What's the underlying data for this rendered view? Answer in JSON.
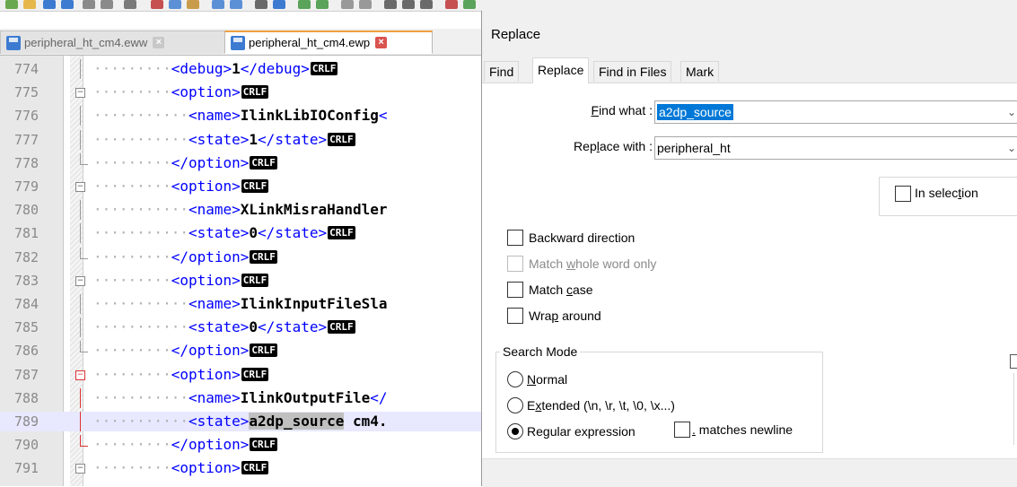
{
  "tabs": [
    {
      "label": "peripheral_ht_cm4.eww",
      "active": false
    },
    {
      "label": "peripheral_ht_cm4.ewp",
      "active": true
    }
  ],
  "crlf_label": "CRLF",
  "editor": {
    "lines": [
      {
        "num": "774",
        "dots": "·········",
        "t1": "<debug>",
        "val": "1",
        "t2": "</debug>",
        "crlf": true
      },
      {
        "num": "775",
        "dots": "·········",
        "t1": "<option>",
        "val": "",
        "t2": "",
        "crlf": true
      },
      {
        "num": "776",
        "dots": "···········",
        "t1": "<name>",
        "val": "IlinkLibIOConfig",
        "t2": "<",
        "crlf": false
      },
      {
        "num": "777",
        "dots": "···········",
        "t1": "<state>",
        "val": "1",
        "t2": "</state>",
        "crlf": true
      },
      {
        "num": "778",
        "dots": "·········",
        "t1": "</option>",
        "val": "",
        "t2": "",
        "crlf": true
      },
      {
        "num": "779",
        "dots": "·········",
        "t1": "<option>",
        "val": "",
        "t2": "",
        "crlf": true
      },
      {
        "num": "780",
        "dots": "···········",
        "t1": "<name>",
        "val": "XLinkMisraHandler",
        "t2": "",
        "crlf": false
      },
      {
        "num": "781",
        "dots": "···········",
        "t1": "<state>",
        "val": "0",
        "t2": "</state>",
        "crlf": true
      },
      {
        "num": "782",
        "dots": "·········",
        "t1": "</option>",
        "val": "",
        "t2": "",
        "crlf": true
      },
      {
        "num": "783",
        "dots": "·········",
        "t1": "<option>",
        "val": "",
        "t2": "",
        "crlf": true
      },
      {
        "num": "784",
        "dots": "···········",
        "t1": "<name>",
        "val": "IlinkInputFileSla",
        "t2": "",
        "crlf": false
      },
      {
        "num": "785",
        "dots": "···········",
        "t1": "<state>",
        "val": "0",
        "t2": "</state>",
        "crlf": true
      },
      {
        "num": "786",
        "dots": "·········",
        "t1": "</option>",
        "val": "",
        "t2": "",
        "crlf": true
      },
      {
        "num": "787",
        "dots": "·········",
        "t1": "<option>",
        "val": "",
        "t2": "",
        "crlf": true
      },
      {
        "num": "788",
        "dots": "···········",
        "t1": "<name>",
        "val": "IlinkOutputFile",
        "t2": "</",
        "crlf": false
      },
      {
        "num": "789",
        "dots": "···········",
        "t1": "<state>",
        "val": "a2dp_source",
        "t2": "",
        "val2": " cm4.",
        "crlf": false
      },
      {
        "num": "790",
        "dots": "·········",
        "t1": "</option>",
        "val": "",
        "t2": "",
        "crlf": true
      },
      {
        "num": "791",
        "dots": "·········",
        "t1": "<option>",
        "val": "",
        "t2": "",
        "crlf": true
      }
    ]
  },
  "dialog": {
    "title": "Replace",
    "tabs": [
      "Find",
      "Replace",
      "Find in Files",
      "Mark"
    ],
    "find_what_label_pre": "",
    "find_what_label_u": "F",
    "find_what_label_post": "ind what :",
    "find_what_value": "a2dp_source",
    "replace_with_label_pre": "Rep",
    "replace_with_label_u": "l",
    "replace_with_label_post": "ace with :",
    "replace_with_value": "peripheral_ht",
    "in_selection_pre": "In selec",
    "in_selection_u": "t",
    "in_selection_post": "ion",
    "backward_direction": "Backward direction",
    "whole_word_pre": "Match ",
    "whole_word_u": "w",
    "whole_word_post": "hole word only",
    "match_case_pre": "Match ",
    "match_case_u": "c",
    "match_case_post": "ase",
    "wrap_around_pre": "Wra",
    "wrap_around_u": "p",
    "wrap_around_post": " around",
    "search_mode_title": "Search Mode",
    "normal_u": "N",
    "normal_post": "ormal",
    "extended_pre": "E",
    "extended_u": "x",
    "extended_post": "tended (\\n, \\r, \\t, \\0, \\x...)",
    "regex_pre": "Re",
    "regex_u": "g",
    "regex_post": "ular expression",
    "matches_newline_u": ".",
    "matches_newline_post": " matches newline",
    "selected_mode": "Regular expression"
  }
}
